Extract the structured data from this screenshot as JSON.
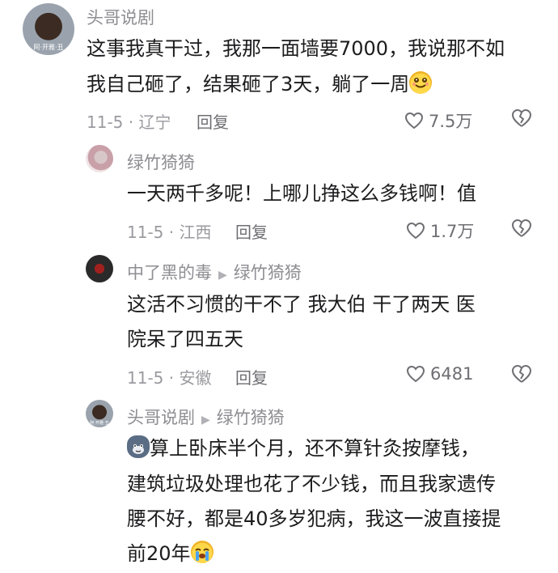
{
  "comments": [
    {
      "author": "头哥说剧",
      "avatar_tag": "阿·开雅·丑",
      "lines": [
        "这事我真干过，我那一面墙要7000，我说那不如",
        "我自己砸了，结果砸了3天，躺了一周"
      ],
      "emoji": "smile-emoji",
      "meta": "11-5 · 辽宁",
      "reply_label": "回复",
      "likes": "7.5万"
    },
    {
      "author": "绿竹猗猗",
      "lines": [
        "一天两千多呢！上哪儿挣这么多钱啊！值"
      ],
      "meta": "11-5 · 江西",
      "reply_label": "回复",
      "likes": "1.7万"
    },
    {
      "author": "中了黑的毒",
      "reply_to": "绿竹猗猗",
      "lines": [
        "这活不习惯的干不了 我大伯 干了两天 医",
        "院呆了四五天"
      ],
      "meta": "11-5 · 安徽",
      "reply_label": "回复",
      "likes": "6481"
    },
    {
      "author": "头哥说剧",
      "reply_to": "绿竹猗猗",
      "avatar_tag": "阿·开雅·丑",
      "lines": [
        "算上卧床半个月，还不算针灸按摩钱，",
        "建筑垃圾处理也花了不少钱，而且我家遗传",
        "腰不好，都是40多岁犯病，我这一波直接提",
        "前20年"
      ],
      "lead_emoji": "cat-emoji",
      "emoji": "crying-emoji"
    }
  ]
}
